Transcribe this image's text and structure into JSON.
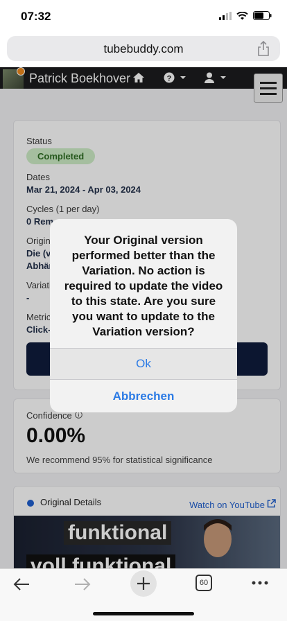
{
  "status_bar": {
    "time": "07:32"
  },
  "browser": {
    "url": "tubebuddy.com",
    "tab_count": "60"
  },
  "header": {
    "user_name": "Patrick Boekhover"
  },
  "test": {
    "status_label": "Status",
    "status_value": "Completed",
    "dates_label": "Dates",
    "dates_value": "Mar 21, 2024 - Apr 03, 2024",
    "cycles_label": "Cycles (1 per day)",
    "cycles_value": "0 Rem",
    "original_label": "Origin",
    "original_value_1": "Die (v",
    "original_value_2": "Abhär",
    "variation_label": "Variati",
    "variation_value": "-",
    "metric_label": "Metric",
    "metric_value": "Click-"
  },
  "confidence": {
    "label": "Confidence",
    "value": "0.00%",
    "note": "We recommend 95% for statistical significance"
  },
  "details": {
    "label": "Original Details",
    "watch_link": "Watch on YouTube",
    "thumb_text_1": "funktional",
    "thumb_text_2": "voll funktional"
  },
  "dialog": {
    "message": "Your Original version performed better than the Variation. No action is required to update the video to this state. Are you sure you want to update to the Variation version?",
    "ok_label": "Ok",
    "cancel_label": "Abbrechen"
  },
  "colors": {
    "accent": "#2c7be5",
    "header_bg": "#1c1c1e",
    "status_pill": "#cfeec7",
    "button_dark": "#0f1c3d"
  }
}
